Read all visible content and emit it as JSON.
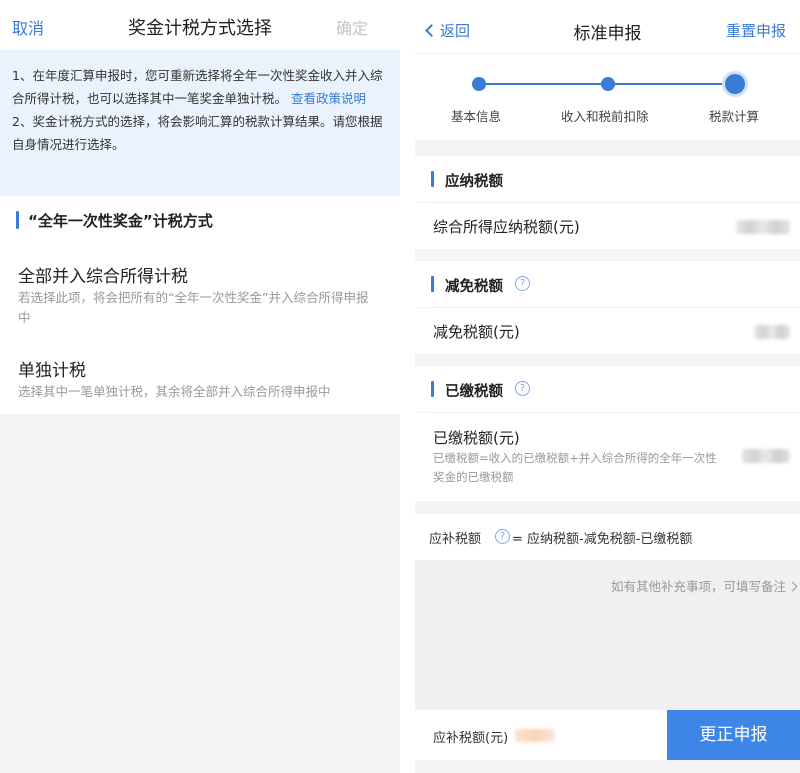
{
  "left": {
    "nav": {
      "cancel": "取消",
      "title": "奖金计税方式选择",
      "confirm": "确定"
    },
    "notice": {
      "p1": "1、在年度汇算申报时，您可重新选择将全年一次性奖金收入并入综合所得计税，也可以选择其中一笔奖金单独计税。",
      "link": "查看政策说明",
      "p2": "2、奖金计税方式的选择，将会影响汇算的税款计算结果。请您根据自身情况进行选择。"
    },
    "section_title": "“全年一次性奖金”计税方式",
    "options": [
      {
        "title": "全部并入综合所得计税",
        "desc": "若选择此项，将会把所有的“全年一次性奖金”并入综合所得申报中"
      },
      {
        "title": "单独计税",
        "desc": "选择其中一笔单独计税，其余将全部并入综合所得申报中"
      }
    ]
  },
  "right": {
    "nav": {
      "back": "返回",
      "title": "标准申报",
      "reset": "重置申报"
    },
    "steps": [
      "基本信息",
      "收入和税前扣除",
      "税款计算"
    ],
    "current_step": 2,
    "sections": {
      "payable": {
        "title": "应纳税额",
        "row_label": "综合所得应纳税额(元)"
      },
      "reduction": {
        "title": "减免税额",
        "row_label": "减免税额(元)"
      },
      "paid": {
        "title": "已缴税额",
        "row_label": "已缴税额(元)",
        "row_desc": "已缴税额=收入的已缴税额+并入综合所得的全年一次性奖金的已缴税额"
      }
    },
    "formula": {
      "label": "应补税额",
      "equation": "= 应纳税额-减免税额-已缴税额"
    },
    "remark": "如有其他补充事项，可填写备注",
    "bottom": {
      "label": "应补税额(元)",
      "submit": "更正申报"
    }
  },
  "colors": {
    "accent": "#3a7bd5",
    "submit_bg": "#3d86e8",
    "notice_bg": "#eaf3fd"
  },
  "icons": [
    "chevron-left-icon",
    "help-circle-icon",
    "chevron-right-icon"
  ]
}
